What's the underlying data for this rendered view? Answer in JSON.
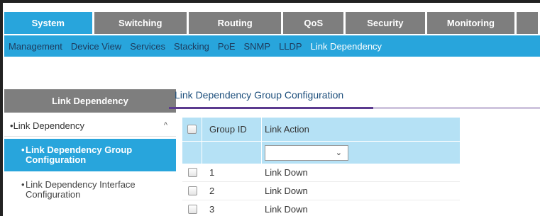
{
  "top_nav": {
    "tabs": [
      {
        "label": "System",
        "active": true
      },
      {
        "label": "Switching",
        "active": false
      },
      {
        "label": "Routing",
        "active": false
      },
      {
        "label": "QoS",
        "active": false
      },
      {
        "label": "Security",
        "active": false
      },
      {
        "label": "Monitoring",
        "active": false
      }
    ]
  },
  "sub_nav": {
    "items": [
      {
        "label": "Management",
        "active": false
      },
      {
        "label": "Device View",
        "active": false
      },
      {
        "label": "Services",
        "active": false
      },
      {
        "label": "Stacking",
        "active": false
      },
      {
        "label": "PoE",
        "active": false
      },
      {
        "label": "SNMP",
        "active": false
      },
      {
        "label": "LLDP",
        "active": false
      },
      {
        "label": "Link Dependency",
        "active": true
      }
    ]
  },
  "sidebar": {
    "header": "Link Dependency",
    "section": {
      "label": "Link Dependency",
      "chevron": "^"
    },
    "items": [
      {
        "label": "Link Dependency Group Configuration",
        "active": true
      },
      {
        "label": "Link Dependency Interface Configuration",
        "active": false
      }
    ]
  },
  "main": {
    "title": "Link Dependency Group Configuration",
    "table": {
      "headers": {
        "group_id": "Group ID",
        "link_action": "Link Action"
      },
      "filter_select_value": "",
      "rows": [
        {
          "group_id": "1",
          "link_action": "Link Down"
        },
        {
          "group_id": "2",
          "link_action": "Link Down"
        },
        {
          "group_id": "3",
          "link_action": "Link Down"
        }
      ]
    }
  },
  "colors": {
    "accent": "#28a5dc",
    "nav_gray": "#7e7e7e",
    "table_header": "#b5e1f5",
    "title_rule": "#5b3a8f"
  }
}
